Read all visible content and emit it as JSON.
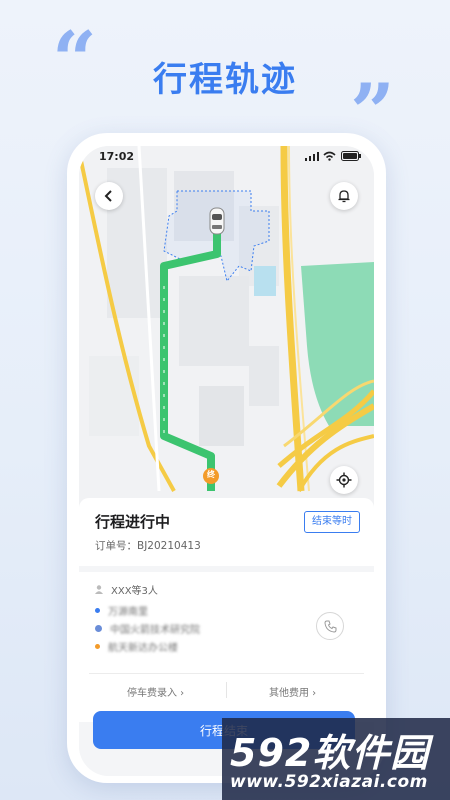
{
  "headline": "行程轨迹",
  "quotes": {
    "open": "“",
    "close": "”"
  },
  "phone": {
    "status_time": "17:02",
    "map": {
      "icons": [
        "back-arrow-icon",
        "bell-icon",
        "locate-icon",
        "car-icon",
        "start-marker-icon"
      ],
      "start_marker_label": "终",
      "colors": {
        "route": "#3cc46f",
        "road_major": "#f5cb45",
        "park": "#8ddbb6",
        "water": "#b8e0ef"
      }
    },
    "trip": {
      "title": "行程进行中",
      "order_label": "订单号：",
      "order_number": "BJ20210413",
      "end_wait_button": "结束等时",
      "passenger": "XXX等3人",
      "stops": [
        {
          "name": "万源南里",
          "color": "#3a7df0"
        },
        {
          "name": "中国火箭技术研究院",
          "color": "#6a8dd8"
        },
        {
          "name": "航天新达办公楼",
          "color": "#f39b2a"
        }
      ],
      "fees": {
        "parking": "停车费录入",
        "other": "其他费用"
      },
      "end_trip_button": "行程结束"
    }
  },
  "watermark": {
    "brand_number": "592",
    "brand_text": "软件园",
    "url": "www.592xiazai.com"
  },
  "colors": {
    "accent": "#3a7df0",
    "quote": "#8fb1f3"
  }
}
